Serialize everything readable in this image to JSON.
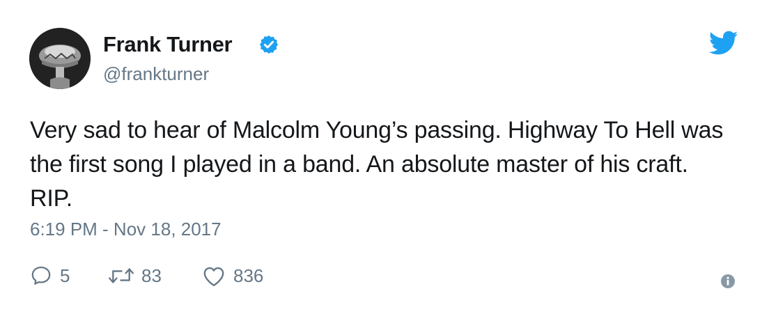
{
  "tweet": {
    "author": {
      "name": "Frank Turner",
      "handle": "@frankturner",
      "verified": true,
      "avatar_icon": "avatar-portrait"
    },
    "text": "Very sad to hear of Malcolm Young’s passing. Highway To Hell was the first song I played in a band. An absolute master of his craft. RIP.",
    "timestamp": "6:19 PM - Nov 18, 2017",
    "actions": {
      "replies": {
        "icon": "reply-icon",
        "count": "5"
      },
      "retweets": {
        "icon": "retweet-icon",
        "count": "83"
      },
      "likes": {
        "icon": "heart-icon",
        "count": "836"
      }
    },
    "info_icon": "info-icon",
    "brand_icon": "twitter-bird-icon"
  },
  "colors": {
    "twitter_blue": "#1da1f2",
    "primary_text": "#14171a",
    "secondary_text": "#657786",
    "background": "#ffffff"
  }
}
